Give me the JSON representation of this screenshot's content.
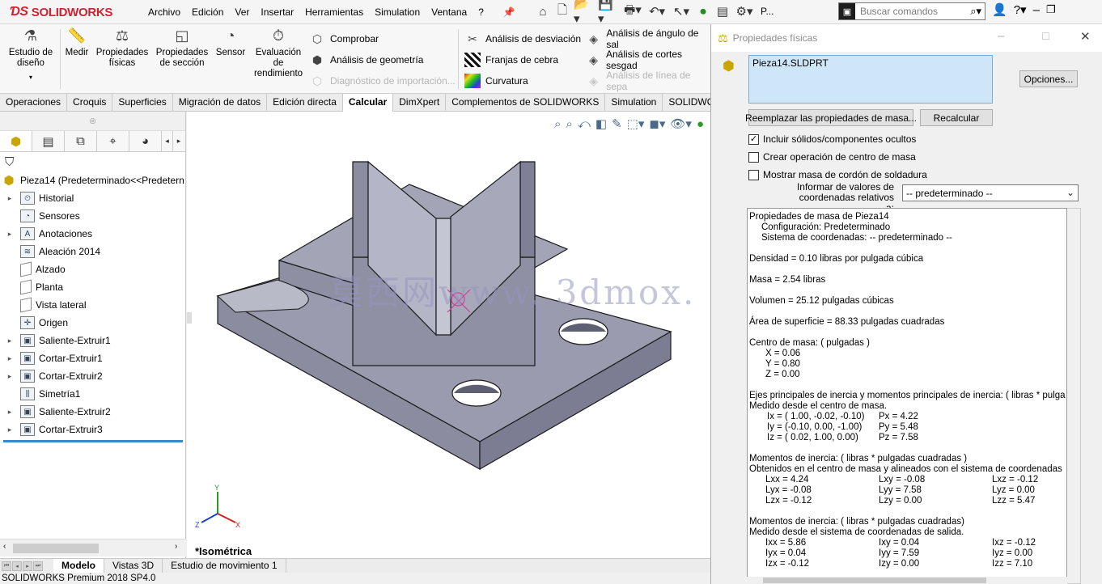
{
  "app": {
    "brand": "SOLIDWORKS",
    "status": "SOLIDWORKS Premium 2018 SP4.0"
  },
  "menu": [
    "Archivo",
    "Edición",
    "Ver",
    "Insertar",
    "Herramientas",
    "Simulation",
    "Ventana",
    "?"
  ],
  "quick": {
    "more": "P..."
  },
  "search": {
    "placeholder": "Buscar comandos"
  },
  "ribbon": {
    "big": [
      {
        "label": "Estudio de diseño",
        "icon": "design-study-icon"
      },
      {
        "label": "Medir",
        "icon": "measure-icon"
      },
      {
        "label": "Propiedades físicas",
        "icon": "mass-properties-icon"
      },
      {
        "label": "Propiedades de sección",
        "icon": "section-properties-icon"
      },
      {
        "label": "Sensor",
        "icon": "sensor-icon"
      },
      {
        "label": "Evaluación de rendimiento",
        "icon": "performance-icon"
      }
    ],
    "col1": [
      {
        "label": "Comprobar",
        "disabled": false
      },
      {
        "label": "Análisis de geometría",
        "disabled": false
      },
      {
        "label": "Diagnóstico de importación...",
        "disabled": true
      }
    ],
    "col2": [
      {
        "label": "Análisis de desviación",
        "disabled": false
      },
      {
        "label": "Franjas de cebra",
        "disabled": false
      },
      {
        "label": "Curvatura",
        "disabled": false
      }
    ],
    "col3": [
      {
        "label": "Análisis de ángulo de sal",
        "disabled": false
      },
      {
        "label": "Análisis de cortes sesgad",
        "disabled": false
      },
      {
        "label": "Análisis de línea de sepa",
        "disabled": true
      }
    ]
  },
  "tabs": [
    "Operaciones",
    "Croquis",
    "Superficies",
    "Migración de datos",
    "Edición directa",
    "Calcular",
    "DimXpert",
    "Complementos de SOLIDWORKS",
    "Simulation",
    "SOLIDWOR"
  ],
  "active_tab": "Calcular",
  "tree": {
    "root": "Pieza14  (Predeterminado<<Predetern",
    "items": [
      {
        "label": "Historial",
        "arrow": true,
        "icon": "history"
      },
      {
        "label": "Sensores",
        "arrow": false,
        "icon": "sensor"
      },
      {
        "label": "Anotaciones",
        "arrow": true,
        "icon": "annotation"
      },
      {
        "label": "Aleación 2014",
        "arrow": false,
        "icon": "material"
      },
      {
        "label": "Alzado",
        "arrow": false,
        "icon": "plane"
      },
      {
        "label": "Planta",
        "arrow": false,
        "icon": "plane"
      },
      {
        "label": "Vista lateral",
        "arrow": false,
        "icon": "plane"
      },
      {
        "label": "Origen",
        "arrow": false,
        "icon": "origin"
      },
      {
        "label": "Saliente-Extruir1",
        "arrow": true,
        "icon": "feature"
      },
      {
        "label": "Cortar-Extruir1",
        "arrow": true,
        "icon": "feature"
      },
      {
        "label": "Cortar-Extruir2",
        "arrow": true,
        "icon": "feature"
      },
      {
        "label": "Simetría1",
        "arrow": false,
        "icon": "mirror"
      },
      {
        "label": "Saliente-Extruir2",
        "arrow": true,
        "icon": "feature"
      },
      {
        "label": "Cortar-Extruir3",
        "arrow": true,
        "icon": "feature"
      }
    ]
  },
  "viewport": {
    "view_name": "*Isométrica",
    "watermark": "莫西网www. 3dmox. com"
  },
  "bottom_tabs": [
    "Modelo",
    "Vistas 3D",
    "Estudio de movimiento 1"
  ],
  "dialog": {
    "title": "Propiedades físicas",
    "selection": "Pieza14.SLDPRT",
    "options_btn": "Opciones...",
    "replace_btn": "Reemplazar las propiedades de masa...",
    "recalc_btn": "Recalcular",
    "checks": [
      {
        "label": "Incluir sólidos/componentes ocultos",
        "checked": true
      },
      {
        "label": "Crear operación de centro de masa",
        "checked": false
      },
      {
        "label": "Mostrar masa de cordón de soldadura",
        "checked": false
      }
    ],
    "coord_label": "Informar de valores de coordenadas relativos a:",
    "coord_value": "-- predeterminado --",
    "results": {
      "l1": "Propiedades de masa de Pieza14",
      "l2": "Configuración:  Predeterminado",
      "l3": "Sistema de coordenadas:  -- predeterminado --",
      "density": "Densidad = 0.10 libras por pulgada cúbica",
      "mass": "Masa = 2.54 libras",
      "volume": "Volumen = 25.12 pulgadas cúbicas",
      "area": "Área de superficie = 88.33 pulgadas cuadradas",
      "com_title": "Centro de masa: ( pulgadas )",
      "com": [
        "X = 0.06",
        "Y = 0.80",
        "Z = 0.00"
      ],
      "axes_title": "Ejes principales de inercia y momentos principales de inercia: ( libras * pulga",
      "axes_sub": "Medido desde el centro de masa.",
      "axes": [
        [
          "Ix = ( 1.00, -0.02, -0.10)",
          "Px = 4.22"
        ],
        [
          "Iy = (-0.10,  0.00, -1.00)",
          "Py = 5.48"
        ],
        [
          "Iz = ( 0.02,  1.00,  0.00)",
          "Pz = 7.58"
        ]
      ],
      "m1_title": "Momentos de inercia: ( libras * pulgadas cuadradas )",
      "m1_sub": "Obtenidos en el centro de masa y alineados con el sistema de coordenadas",
      "m1": [
        [
          "Lxx = 4.24",
          "Lxy = -0.08",
          "Lxz = -0.12"
        ],
        [
          "Lyx = -0.08",
          "Lyy = 7.58",
          "Lyz = 0.00"
        ],
        [
          "Lzx = -0.12",
          "Lzy = 0.00",
          "Lzz = 5.47"
        ]
      ],
      "m2_title": "Momentos de inercia: ( libras * pulgadas cuadradas)",
      "m2_sub": "Medido desde el sistema de coordenadas de salida.",
      "m2": [
        [
          "Ixx = 5.86",
          "Ixy = 0.04",
          "Ixz = -0.12"
        ],
        [
          "Iyx = 0.04",
          "Iyy = 7.59",
          "Iyz = 0.00"
        ],
        [
          "Izx = -0.12",
          "Izy = 0.00",
          "Izz = 7.10"
        ]
      ]
    }
  },
  "colors": {
    "brand": "#d2202f",
    "selection": "#cfe6f8",
    "part": "#9a9bae",
    "tree_end": "#3b88c4"
  }
}
